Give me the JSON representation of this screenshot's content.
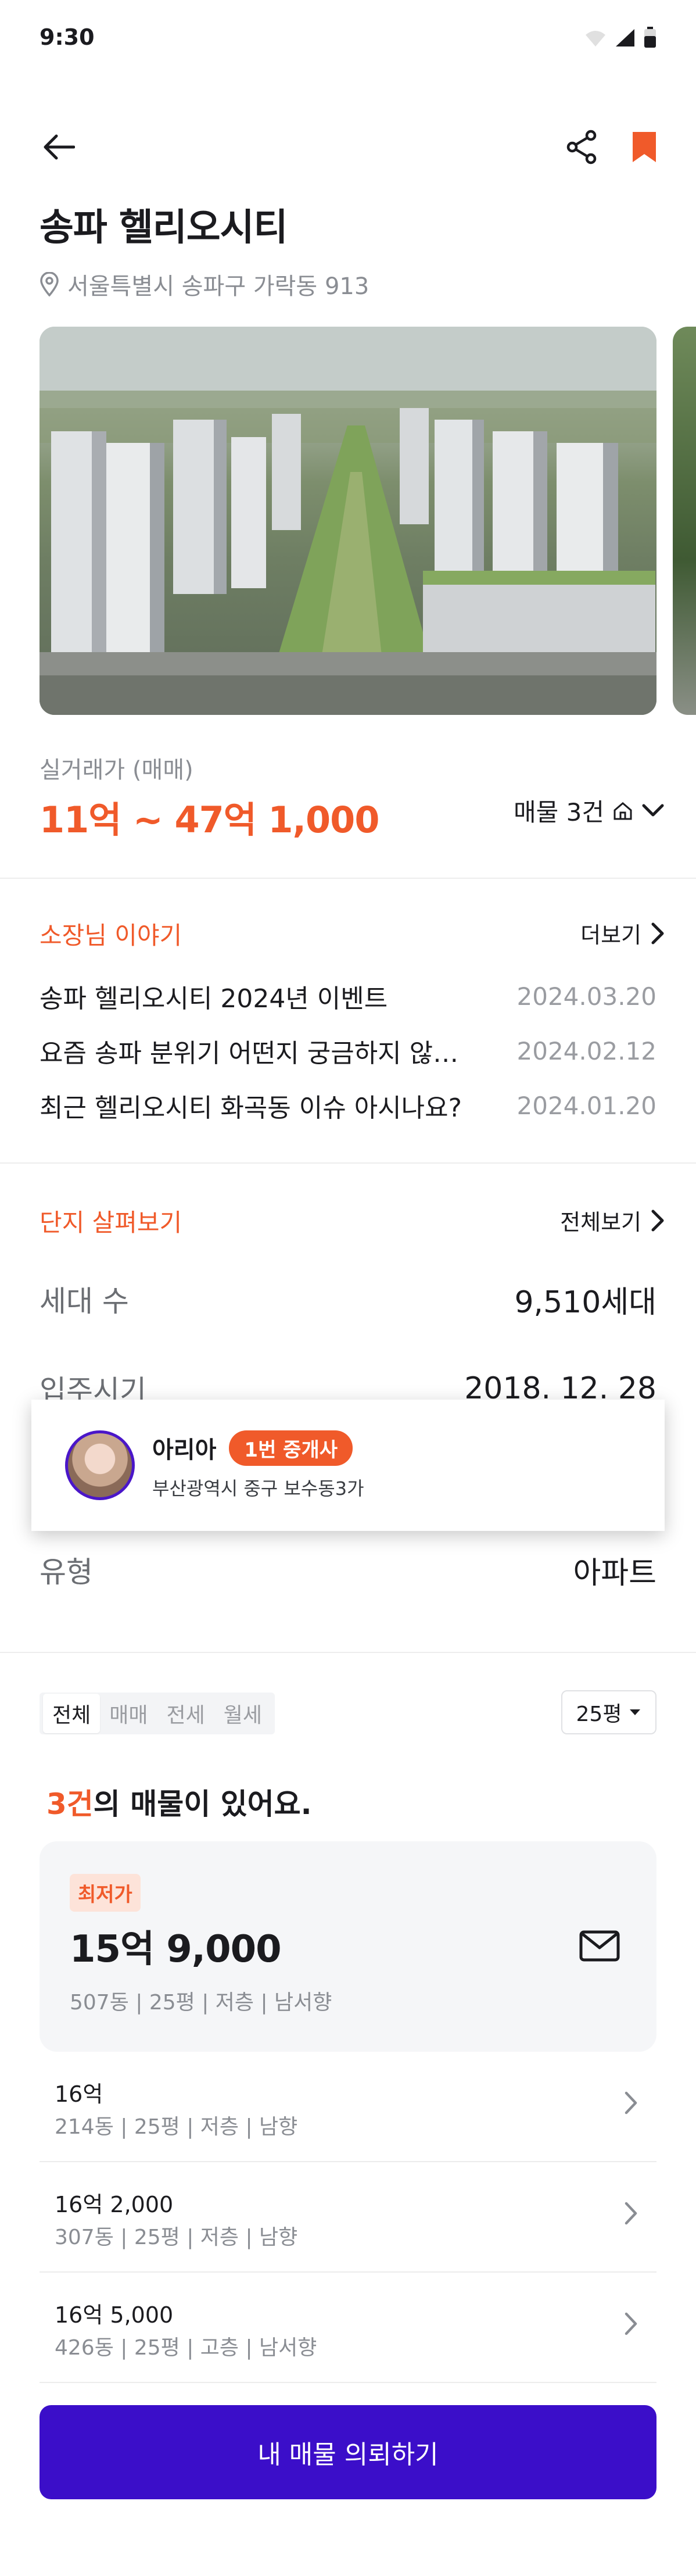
{
  "status_bar": {
    "time": "9:30"
  },
  "property": {
    "title": "송파 헬리오시티",
    "address": "서울특별시 송파구 가락동 913",
    "price_label": "실거래가 (매매)",
    "price_range": "11억 ~ 47억 1,000",
    "listing_count": "매물 3건"
  },
  "owner_story": {
    "section_title": "소장님 이야기",
    "more_label": "더보기",
    "items": [
      {
        "title": "송파 헬리오시티 2024년 이벤트",
        "date": "2024.03.20"
      },
      {
        "title": "요즘 송파 분위기 어떤지 궁금하지 않으세요?",
        "date": "2024.02.12"
      },
      {
        "title": "최근 헬리오시티 화곡동 이슈 아시나요?",
        "date": "2024.01.20"
      }
    ]
  },
  "complex": {
    "section_title": "단지 살펴보기",
    "more_label": "전체보기",
    "rows": [
      {
        "label": "세대 수",
        "value": "9,510세대"
      },
      {
        "label": "입주시기",
        "value": "2018. 12. 28"
      },
      {
        "label": "유형",
        "value": "아파트"
      }
    ]
  },
  "agent": {
    "name": "아리아",
    "badge": "1번 중개사",
    "address": "부산광역시 중구 보수동3가"
  },
  "filters": {
    "tabs": [
      "전체",
      "매매",
      "전세",
      "월세"
    ],
    "active_tab": "전체",
    "size": "25평"
  },
  "listings_header": {
    "count": "3건",
    "suffix": "의 매물이 있어요."
  },
  "best": {
    "badge": "최저가",
    "price": "15억 9,000",
    "detail": "507동 | 25평 | 저층 | 남서향"
  },
  "listings": [
    {
      "price": "16억",
      "detail": "214동 | 25평 | 저층 | 남향"
    },
    {
      "price": "16억 2,000",
      "detail": "307동 | 25평 | 저층 | 남향"
    },
    {
      "price": "16억 5,000",
      "detail": "426동 | 25평 | 고층 | 남서향"
    }
  ],
  "cta": {
    "label": "내 매물 의뢰하기"
  },
  "colors": {
    "accent": "#f05a2a",
    "primary": "#3b0ec9"
  }
}
